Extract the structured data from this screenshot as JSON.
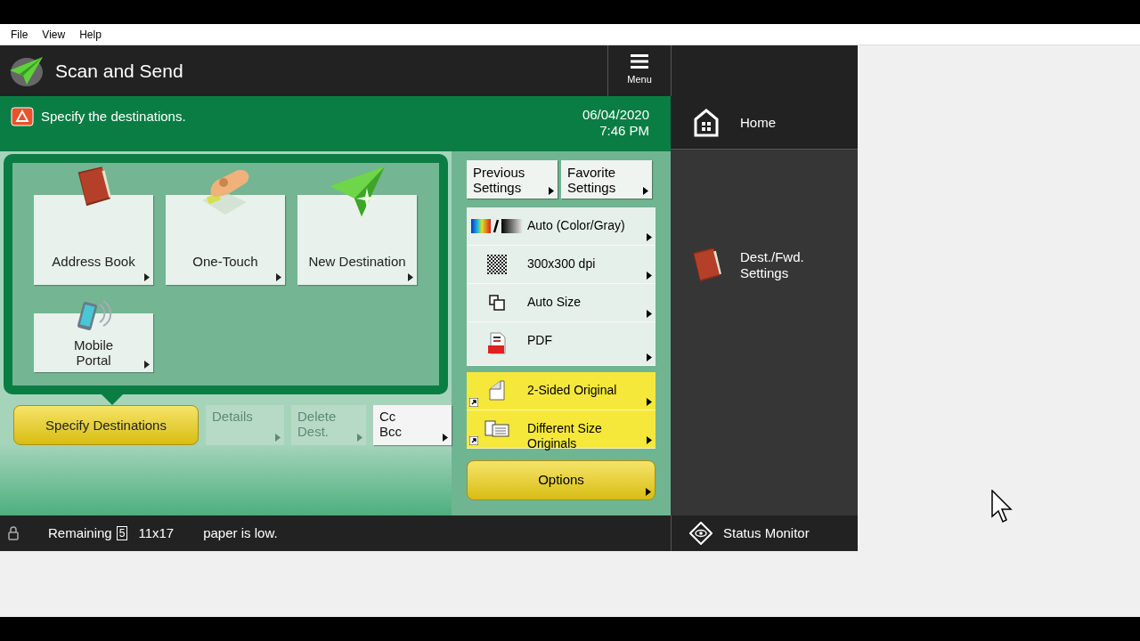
{
  "menu_bar": [
    "File",
    "View",
    "Help"
  ],
  "header": {
    "title": "Scan and Send",
    "menu_button": "Menu"
  },
  "message_bar": {
    "message": "Specify the destinations.",
    "date": "06/04/2020",
    "time": "7:46 PM"
  },
  "destination_tiles": [
    {
      "kind": "book",
      "label": "Address Book"
    },
    {
      "kind": "touch",
      "label": "One-Touch"
    },
    {
      "kind": "plane",
      "label": "New Destination"
    },
    {
      "kind": "mobile",
      "label": "Mobile Portal"
    }
  ],
  "action_buttons": [
    {
      "kind": "primary",
      "label": "Specify Destinations",
      "disabled": false
    },
    {
      "kind": "secondary",
      "label": "Details",
      "disabled": true
    },
    {
      "kind": "secondary",
      "label": "Delete Dest.",
      "disabled": true
    },
    {
      "kind": "secondary",
      "label": "Cc Bcc",
      "disabled": false
    }
  ],
  "settings_buttons": [
    "Previous Settings",
    "Favorite Settings"
  ],
  "settings": [
    {
      "kind": "color",
      "label": "Auto (Color/Gray)",
      "highlighted": false
    },
    {
      "kind": "resolution",
      "label": "300x300 dpi",
      "highlighted": false
    },
    {
      "kind": "size",
      "label": "Auto Size",
      "highlighted": false
    },
    {
      "kind": "pdf",
      "label": "PDF",
      "highlighted": false
    },
    {
      "kind": "two-sided",
      "label": "2-Sided Original",
      "highlighted": true
    },
    {
      "kind": "mixed",
      "label": "Different Size Originals",
      "highlighted": true
    }
  ],
  "options_button": "Options",
  "side_panel": [
    {
      "kind": "home",
      "label": "Home"
    },
    {
      "kind": "book",
      "label": "Dest./Fwd. Settings"
    }
  ],
  "status_bar": {
    "remaining_label": "Remaining",
    "remaining_count": "5",
    "paper_size": "11x17",
    "message": "paper is low.",
    "status_monitor": "Status Monitor"
  }
}
